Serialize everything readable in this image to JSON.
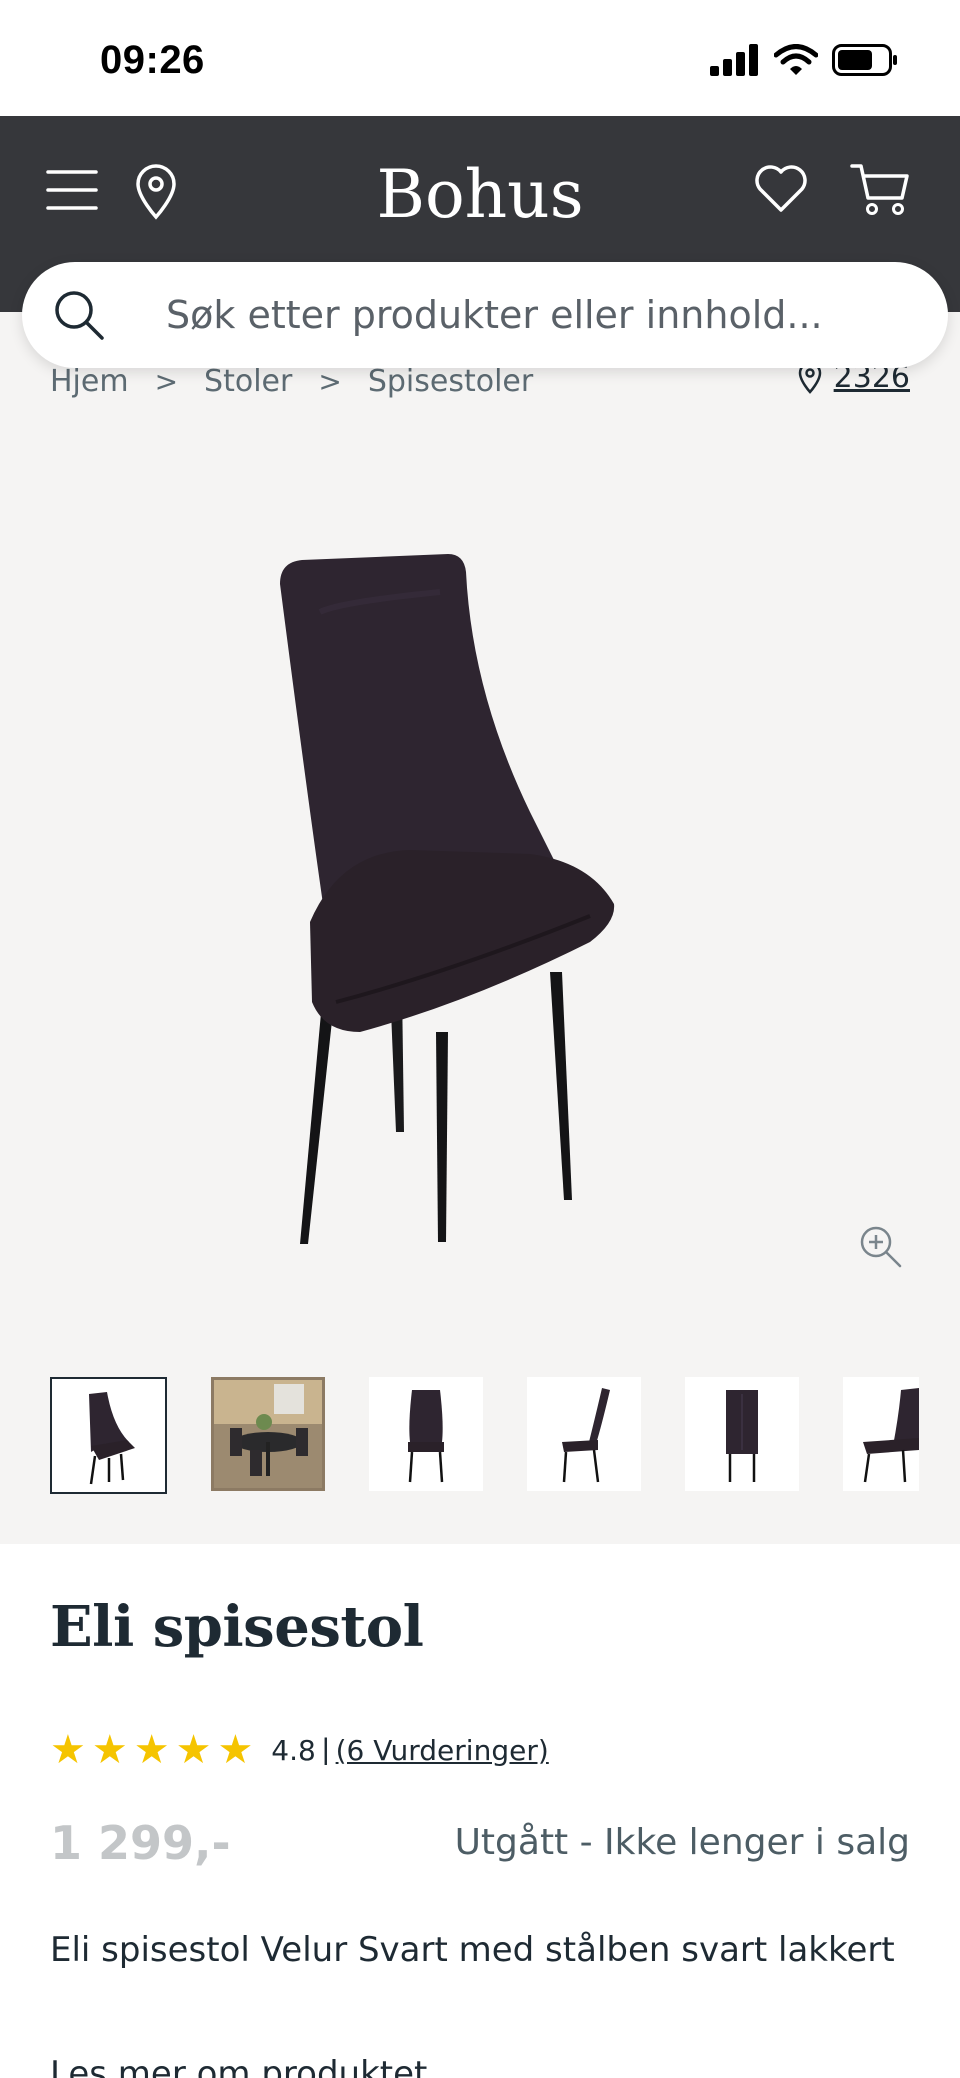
{
  "status_bar": {
    "time": "09:26"
  },
  "header": {
    "logo": "Bohus",
    "icons": [
      "menu-icon",
      "location-pin-icon",
      "heart-icon",
      "cart-icon"
    ]
  },
  "search": {
    "placeholder": "Søk etter produkter eller innhold..."
  },
  "breadcrumb": {
    "items": [
      "Hjem",
      "Stoler",
      "Spisestoler"
    ],
    "separator": ">"
  },
  "store": {
    "code": "2326"
  },
  "gallery": {
    "thumbnail_count": 6,
    "active_index": 0
  },
  "product": {
    "title": "Eli spisestol",
    "rating_value": "4.8",
    "rating_separator": "|",
    "rating_count": "(6 Vurderinger)",
    "stars": 5,
    "price": "1 299,-",
    "status": "Utgått - Ikke lenger i salg",
    "description": "Eli spisestol Velur Svart med stålben svart lakkert",
    "read_more": "Les mer om produktet"
  },
  "colors": {
    "header_bg": "#36373b",
    "gallery_bg": "#f5f4f3",
    "star": "#f5c400",
    "text": "#1e2a33",
    "price_disabled": "#c3c6c8"
  }
}
